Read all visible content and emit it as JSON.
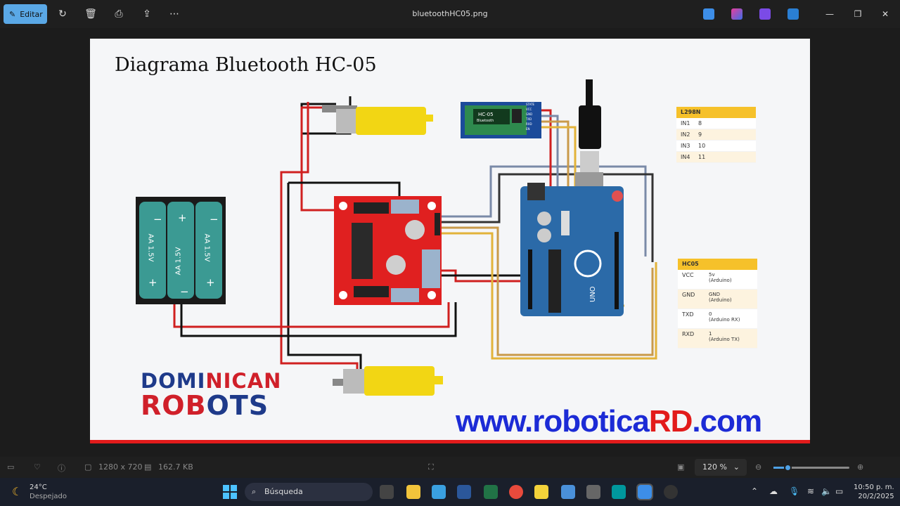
{
  "toolbar": {
    "edit_label": "Editar",
    "filename": "bluetoothHC05.png"
  },
  "diagram": {
    "title": "Diagrama Bluetooth HC-05",
    "logo_line1_a": "DOMI",
    "logo_line1_b": "NICAN",
    "logo_line2_a": "ROB",
    "logo_line2_b": "OTS",
    "website_a": "www.robotica",
    "website_b": "RD",
    ".com": ".com",
    "website_c": ".com",
    "battery_labels": [
      "AA 1.5V",
      "AA 1.5V",
      "AA 1.5V"
    ],
    "hc05_chip_text": "HC-05",
    "hc05_chip_sub": "Bluetooth",
    "hc05_pins": [
      "STATE",
      "VCC",
      "GND",
      "TXD",
      "RXD",
      "EN"
    ],
    "l298n_table": {
      "header": "L298N",
      "rows": [
        {
          "k": "IN1",
          "v": "8"
        },
        {
          "k": "IN2",
          "v": "9"
        },
        {
          "k": "IN3",
          "v": "10"
        },
        {
          "k": "IN4",
          "v": "11"
        }
      ]
    },
    "hc05_table": {
      "header": "HC05",
      "rows": [
        {
          "k": "VCC",
          "v": "5v",
          "n": "(Arduino)"
        },
        {
          "k": "GND",
          "v": "GND",
          "n": "(Arduino)"
        },
        {
          "k": "TXD",
          "v": "0",
          "n": "(Arduino RX)"
        },
        {
          "k": "RXD",
          "v": "1",
          "n": "(Arduino TX)"
        }
      ]
    },
    "arduino_text": "UNO"
  },
  "status": {
    "dimensions": "1280 x 720",
    "size": "162.7 KB",
    "zoom": "120 %"
  },
  "taskbar": {
    "temp": "24°C",
    "weather": "Despejado",
    "search": "Búsqueda",
    "time": "10:50 p. m.",
    "date": "20/2/2025"
  }
}
